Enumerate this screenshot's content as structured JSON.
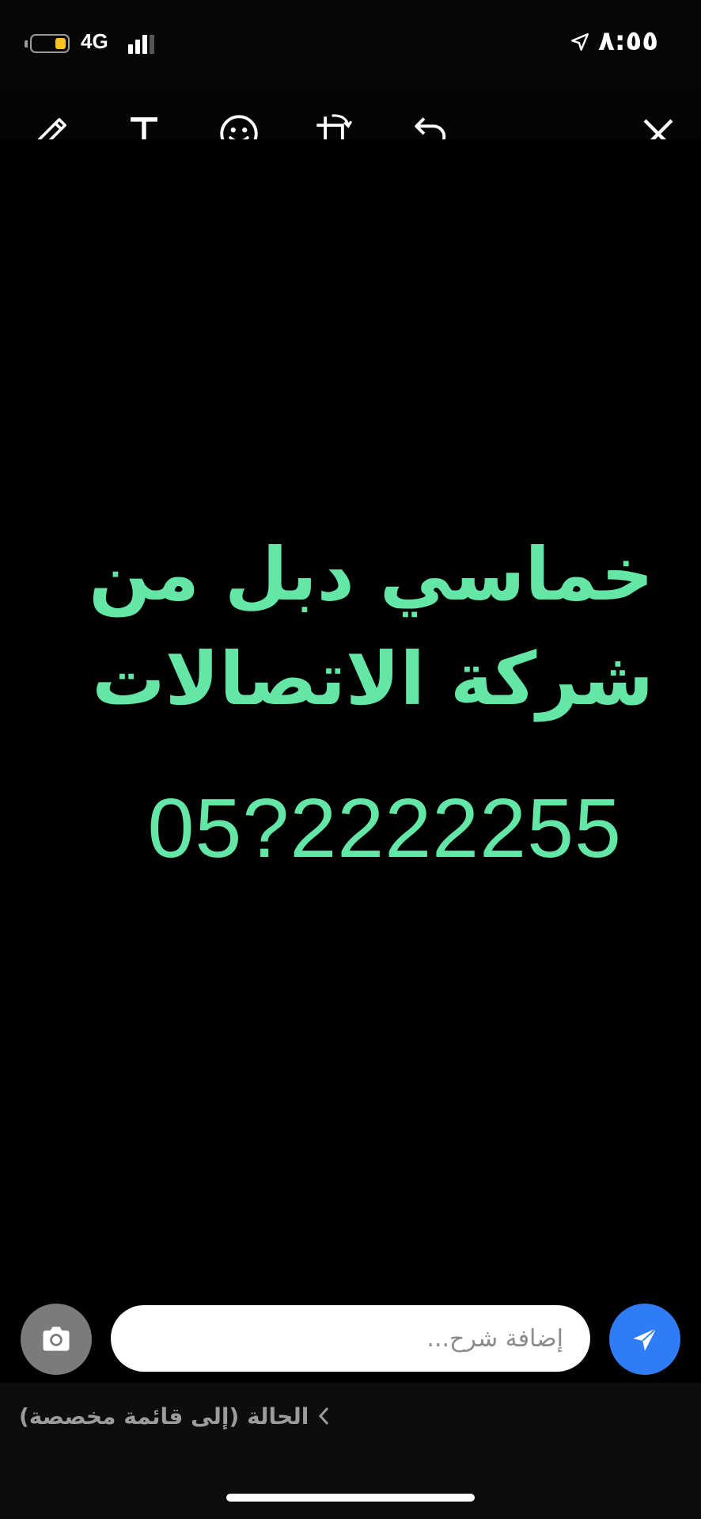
{
  "status_bar": {
    "network": "4G",
    "time": "٨:٥٥",
    "battery_level": 0.25,
    "signal_bars": 3,
    "colors": {
      "battery_fill": "#f7c325"
    }
  },
  "toolbar": {
    "icons": [
      "pencil-icon",
      "text-icon",
      "emoji-icon",
      "crop-rotate-icon",
      "undo-icon",
      "close-icon"
    ]
  },
  "content": {
    "line1": "خماسي دبل من",
    "line2": "شركة الاتصالات",
    "number": "05?2222255",
    "text_color": "#63e6a6"
  },
  "compose": {
    "caption_placeholder": "إضافة شرح...",
    "camera_icon": "camera-icon",
    "send_icon": "send-icon",
    "send_color": "#2f7cf6"
  },
  "footer": {
    "audience_label": "الحالة (إلى قائمة مخصصة)"
  }
}
